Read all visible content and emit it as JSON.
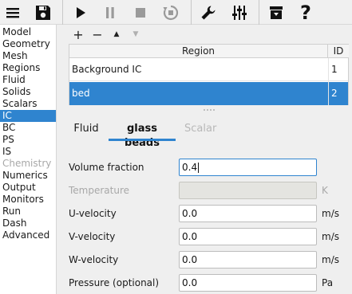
{
  "toolbar": {
    "icons": [
      "hamburger-menu-icon",
      "save-icon",
      "play-icon",
      "pause-icon",
      "stop-icon",
      "reset-icon",
      "wrench-icon",
      "sliders-icon",
      "archive-icon",
      "help-icon"
    ],
    "help_label": "?"
  },
  "sidebar": {
    "items": [
      {
        "label": "Model",
        "state": "normal"
      },
      {
        "label": "Geometry",
        "state": "normal"
      },
      {
        "label": "Mesh",
        "state": "normal"
      },
      {
        "label": "Regions",
        "state": "normal"
      },
      {
        "label": "Fluid",
        "state": "normal"
      },
      {
        "label": "Solids",
        "state": "normal"
      },
      {
        "label": "Scalars",
        "state": "normal"
      },
      {
        "label": "IC",
        "state": "selected"
      },
      {
        "label": "BC",
        "state": "normal"
      },
      {
        "label": "PS",
        "state": "normal"
      },
      {
        "label": "IS",
        "state": "normal"
      },
      {
        "label": "Chemistry",
        "state": "disabled"
      },
      {
        "label": "Numerics",
        "state": "normal"
      },
      {
        "label": "Output",
        "state": "normal"
      },
      {
        "label": "Monitors",
        "state": "normal"
      },
      {
        "label": "Run",
        "state": "normal"
      },
      {
        "label": "Dash",
        "state": "normal"
      },
      {
        "label": "Advanced",
        "state": "normal"
      }
    ]
  },
  "region_controls": {
    "add_label": "+",
    "remove_label": "−",
    "up_label": "▲",
    "down_label": "▼"
  },
  "region_table": {
    "headers": {
      "region": "Region",
      "id": "ID"
    },
    "rows": [
      {
        "region": "Background IC",
        "id": "1",
        "selected": false
      },
      {
        "region": "bed",
        "id": "2",
        "selected": true
      }
    ]
  },
  "tabs": [
    {
      "label": "Fluid",
      "state": "normal"
    },
    {
      "label": "glass beads",
      "state": "active"
    },
    {
      "label": "Scalar",
      "state": "disabled"
    }
  ],
  "form": {
    "volume_fraction": {
      "label": "Volume fraction",
      "value": "0.4",
      "unit": ""
    },
    "temperature": {
      "label": "Temperature",
      "value": "",
      "unit": "K"
    },
    "u_velocity": {
      "label": "U-velocity",
      "value": "0.0",
      "unit": "m/s"
    },
    "v_velocity": {
      "label": "V-velocity",
      "value": "0.0",
      "unit": "m/s"
    },
    "w_velocity": {
      "label": "W-velocity",
      "value": "0.0",
      "unit": "m/s"
    },
    "pressure": {
      "label": "Pressure (optional)",
      "value": "0.0",
      "unit": "Pa"
    }
  },
  "colors": {
    "accent": "#2f84cf",
    "selected_text": "#ffffff",
    "disabled_text": "#a8a8a8"
  }
}
